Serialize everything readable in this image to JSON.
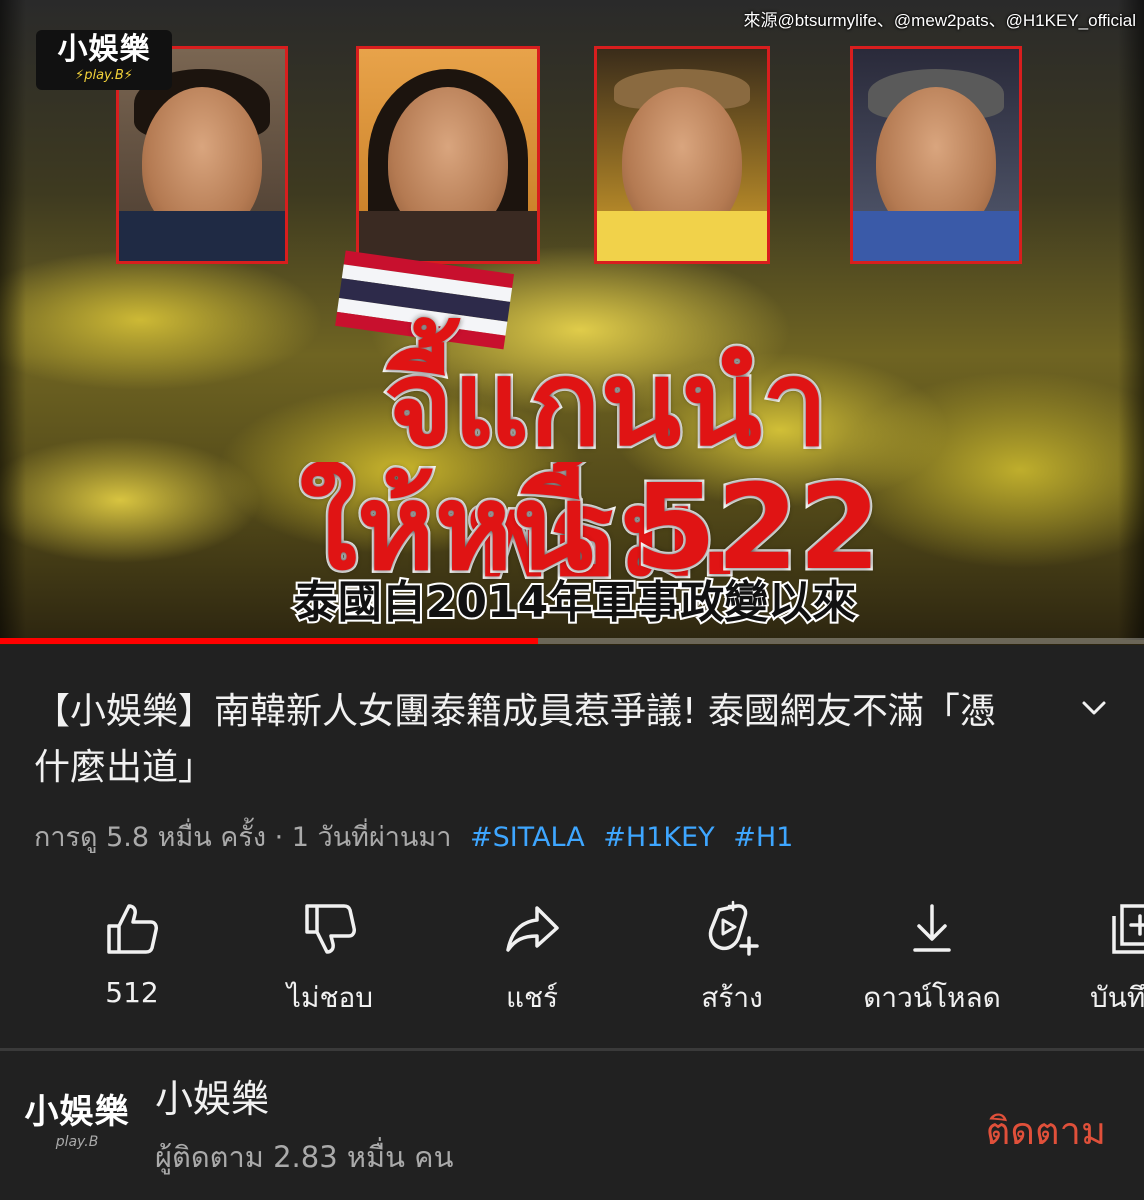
{
  "video": {
    "source_credit": "來源@btsurmylife、@mew2pats、@H1KEY_official",
    "logo_main": "小娛樂",
    "logo_sub": "⚡play.B⚡",
    "headline_line1": "จี้แกนนำ พธม.",
    "headline_line2": "ให้หนี้ 522 ล",
    "caption": "泰國自2014年軍事政變以來",
    "progress": 0.47
  },
  "details": {
    "title": "【小娛樂】南韓新人女團泰籍成員惹爭議! 泰國網友不滿「憑什麼出道」",
    "views_time": "การดู 5.8 หมื่น ครั้ง · 1 วันที่ผ่านมา",
    "hashtags": [
      "#SITALA",
      "#H1KEY",
      "#H1"
    ]
  },
  "actions": {
    "like_label": "512",
    "dislike_label": "ไม่ชอบ",
    "share_label": "แชร์",
    "create_label": "สร้าง",
    "download_label": "ดาวน์โหลด",
    "save_label": "บันทึก"
  },
  "channel": {
    "name": "小娛樂",
    "avatar_main": "小娛樂",
    "avatar_sub": "play.B",
    "subscribers": "ผู้ติดตาม 2.83 หมื่น คน",
    "subscribe_label": "ติดตาม"
  },
  "colors": {
    "background": "#212121",
    "accent_red": "#ff0000",
    "hashtag_blue": "#3ea6ff",
    "subscribe_red": "#e0503a"
  },
  "icons": {
    "expand": "chevron-down-icon",
    "like": "thumbs-up-icon",
    "dislike": "thumbs-down-icon",
    "share": "share-arrow-icon",
    "create": "create-sparkle-icon",
    "download": "download-icon",
    "save": "save-to-playlist-icon"
  }
}
